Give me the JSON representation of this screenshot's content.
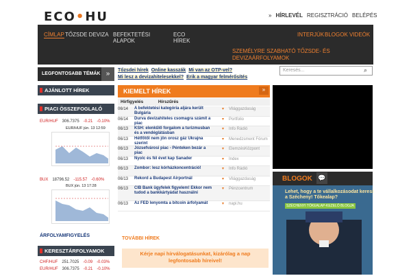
{
  "logo": {
    "left": "ECO",
    "dot": "•",
    "right": "HU"
  },
  "toplinks": {
    "arrow": "»",
    "newsletter": "HÍRLEVÉL",
    "register": "REGISZTRÁCIÓ",
    "login": "BELÉPÉS"
  },
  "nav": {
    "home": "CÍMLAP",
    "market": "TŐZSDE DEVIZA",
    "funds1": "BEFEKTETÉSI",
    "funds2": "ALAPOK",
    "eco1": "ECO",
    "eco2": "HÍREK",
    "interviews": "INTERJÚK",
    "blogs": "BLOGOK",
    "videos": "VIDEÓK",
    "promo1": "SZEMÉLYRE SZABHATÓ TŐZSDE- ÉS",
    "promo2": "DEVIZAÁRFOLYAMOK"
  },
  "topics": {
    "label": "LEGFONTOSABB TÉMÁK",
    "arrow": "»"
  },
  "tags": [
    "Tőzsdei hírek",
    "Online kasszák",
    "Mi van az OTP-vel?",
    "Mi lesz a devizahitelesekkel?",
    "Erik a magyar felmérősítés"
  ],
  "search": {
    "placeholder": "Keresés..."
  },
  "sidebar": {
    "recommended": "AJÁNLOTT HÍREK",
    "market": "PIACI ÖSSZEFOGLALÓ",
    "watch": "ÁRFOLYAMFIGYELÉS",
    "cross": "KERESZTÁRFOLYAMOK"
  },
  "rates": [
    {
      "name": "EUR/HUF",
      "v": "306.7375",
      "c": "-0.21",
      "p": "-0.10%"
    },
    {
      "name": "BUX",
      "v": "18796.52",
      "c": "-115.57",
      "p": "-0.60%"
    },
    {
      "name": "CHF/HUF",
      "v": "251.7025",
      "c": "-0.09",
      "p": "-0.03%"
    },
    {
      "name": "EUR/HUF",
      "v": "306.7375",
      "c": "-0.21",
      "p": "-0.10%"
    }
  ],
  "charts": [
    {
      "title": "EUR/HUF jún. 13 12:59",
      "y": [
        "307.2",
        "307",
        "306.8",
        "306.6"
      ],
      "x": [
        "10:00",
        "12:00",
        "14:00",
        "16:00"
      ]
    },
    {
      "title": "BUX jún. 13 17:28",
      "y": [
        "18900",
        "18850",
        "18800",
        "18760",
        "18700"
      ],
      "x": [
        "10:00",
        "12:00",
        "14:00",
        "16:00"
      ]
    }
  ],
  "kiemelt": {
    "title": "KIEMELT HÍREK",
    "btn": "»",
    "f1": "Hírfigyelés",
    "f2": "Hírszűrés"
  },
  "news": [
    {
      "d": "06/14",
      "t": "A befektetési kategória aljára került Bulgária",
      "s": "Világgazdaság"
    },
    {
      "d": "06/14",
      "t": "Durva devizahiteles csomagra számít a piac",
      "s": "Portfolio"
    },
    {
      "d": "06/13",
      "t": "KSH: elenkűlő forgalom a turizmusban és a vendéglátásban",
      "s": "Info Rádió"
    },
    {
      "d": "06/13",
      "t": "Hétfőtől nem jön orosz gáz Ukrajna szerint",
      "s": "Menedzsment Fórum"
    },
    {
      "d": "06/13",
      "t": "Józsefvárosi piac - Pénteken bezár a piac",
      "s": "ElemzésKözpont"
    },
    {
      "d": "06/13",
      "t": "Nyolc és fél évet kap Sanader",
      "s": "Index"
    },
    {
      "d": "06/13",
      "t": "Zombor: lesz kórházkoncentráció!",
      "s": "Info Rádió"
    },
    {
      "d": "06/13",
      "t": "Rekord a Budapest Airportnál",
      "s": "Világgazdaság"
    },
    {
      "d": "06/13",
      "t": "CIB Bank ügyfelek figyelem! Ekkor nem tudod a bankkártyádat használni",
      "s": "Pénzcentrum"
    },
    {
      "d": "06/13",
      "t": "Az FED lenyomta a bitcoin árfolyamát",
      "s": "napi.hu"
    }
  ],
  "more": "TOVÁBBI HÍREK",
  "promo": {
    "l1": "Kérje napi hírválogatásunkat, kizárólag a nap",
    "l2": "legfontosabb híreivel!"
  },
  "blog": {
    "title": "BLOGOK",
    "text": "Lehet, hogy a te vállalkozásodat keresi a Szécheny! Tőkealap?",
    "tag": "SZÉCHENYI TŐKEALAP-KEZELŐ BLOGJA"
  }
}
